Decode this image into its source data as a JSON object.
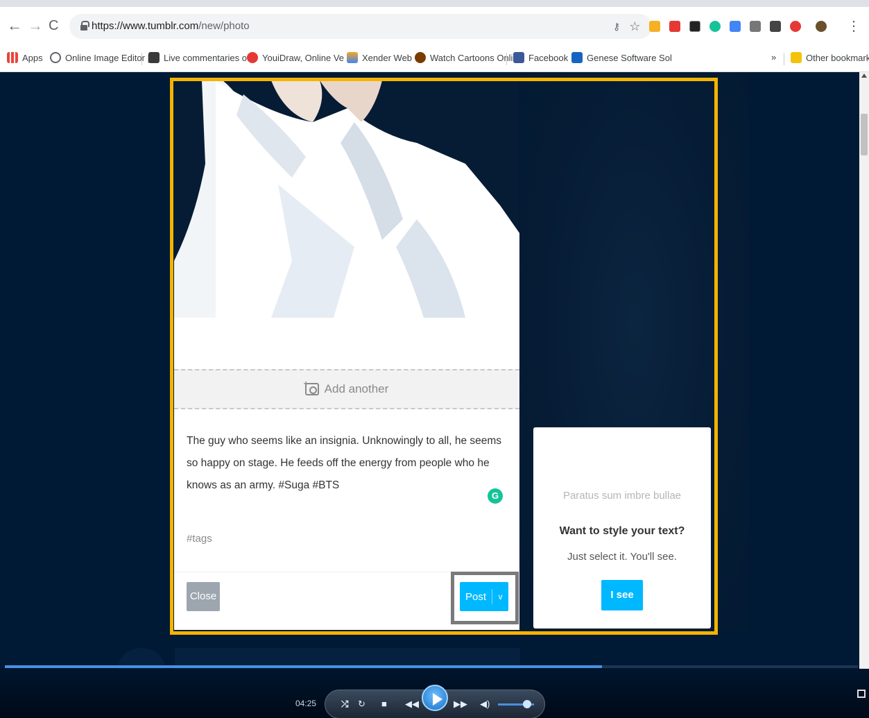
{
  "browser": {
    "url_host": "https://www.tumblr.com",
    "url_path": "/new/photo",
    "bookmarks": [
      {
        "label": "Apps",
        "icon": "apps-grid-icon",
        "color": "#e8453c"
      },
      {
        "label": "Online Image Editor |",
        "icon": "globe-icon",
        "color": "#5f6368"
      },
      {
        "label": "Live commentaries o",
        "icon": "live-commentary-icon",
        "color": "#3a3a3a"
      },
      {
        "label": "YouiDraw, Online Ve",
        "icon": "youidraw-icon",
        "color": "#e53935"
      },
      {
        "label": "Xender Web",
        "icon": "xender-icon",
        "color": "#f5a623"
      },
      {
        "label": "Watch Cartoons Onli",
        "icon": "cartoon-icon",
        "color": "#7a3b00"
      },
      {
        "label": "Facebook",
        "icon": "facebook-icon",
        "color": "#3b5998"
      },
      {
        "label": "Genese Software Sol",
        "icon": "genese-icon",
        "color": "#1565c0"
      }
    ],
    "overflow": "»",
    "other_bookmarks": "Other bookmarks"
  },
  "post": {
    "add_another": "Add another",
    "caption": "The guy who seems like an insignia. Unknowingly to all, he seems so happy on stage. He feeds off the energy from people who he knows as an army. #Suga #BTS",
    "grammarly": "G",
    "tags_placeholder": "#tags",
    "close_label": "Close",
    "post_label": "Post",
    "post_menu_chevron": "v"
  },
  "tooltip": {
    "placeholder": "Paratus sum imbre bullae",
    "title": "Want to style your text?",
    "body": "Just select it. You'll see.",
    "button": "I see"
  },
  "player": {
    "time": "04:25",
    "progress": 0.7
  },
  "colors": {
    "tumblr_blue": "#00b8ff",
    "page_bg": "#001935",
    "highlight": "#f4b400"
  }
}
